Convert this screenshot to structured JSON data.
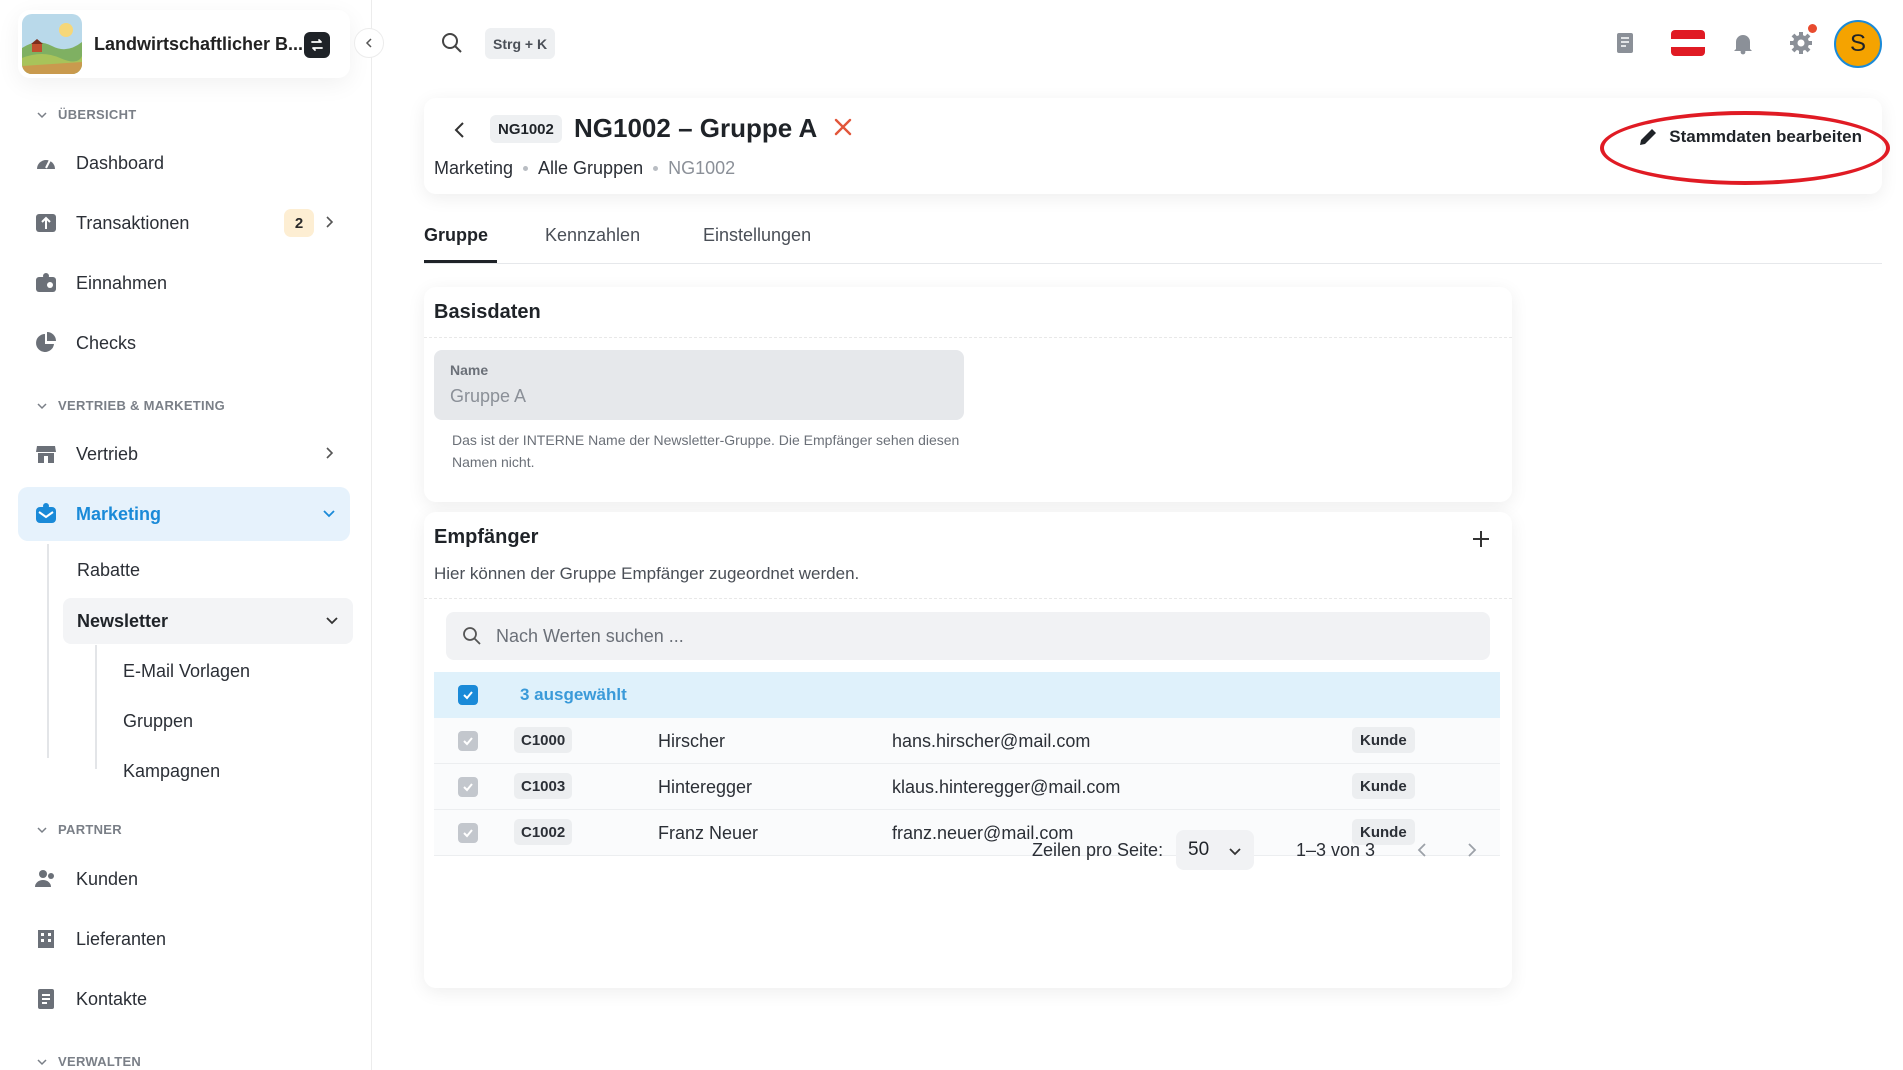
{
  "app": {
    "brand_name": "Landwirtschaftlicher B...",
    "accent_color": "#1a8ad8",
    "highlight_color": "#e01b24"
  },
  "sidebar": {
    "sections": {
      "overview": "ÜBERSICHT",
      "sales_marketing": "VERTRIEB & MARKETING",
      "partner": "PARTNER",
      "manage": "VERWALTEN"
    },
    "items": {
      "dashboard": "Dashboard",
      "transactions": "Transaktionen",
      "transactions_badge": "2",
      "income": "Einnahmen",
      "checks": "Checks",
      "sales": "Vertrieb",
      "marketing": "Marketing",
      "customers": "Kunden",
      "suppliers": "Lieferanten",
      "contacts": "Kontakte"
    },
    "marketing_sub": {
      "discounts": "Rabatte",
      "newsletter": "Newsletter",
      "email_templates": "E-Mail Vorlagen",
      "groups": "Gruppen",
      "campaigns": "Kampagnen"
    }
  },
  "topbar": {
    "search_shortcut": "Strg + K",
    "avatar_initial": "S"
  },
  "header": {
    "code": "NG1002",
    "title": "NG1002 – Gruppe A",
    "breadcrumb": [
      "Marketing",
      "Alle Gruppen",
      "NG1002"
    ],
    "edit_button": "Stammdaten bearbeiten"
  },
  "tabs": [
    "Gruppe",
    "Kennzahlen",
    "Einstellungen"
  ],
  "basisdaten": {
    "title": "Basisdaten",
    "name_label": "Name",
    "name_value": "Gruppe A",
    "helper": "Das ist der INTERNE Name der Newsletter-Gruppe. Die Empfänger sehen diesen Namen nicht."
  },
  "recipients": {
    "title": "Empfänger",
    "subtitle": "Hier können der Gruppe Empfänger zugeordnet werden.",
    "search_placeholder": "Nach Werten suchen ...",
    "selected_label": "3 ausgewählt",
    "rows": [
      {
        "code": "C1000",
        "name": "Hirscher",
        "email": "hans.hirscher@mail.com",
        "type": "Kunde"
      },
      {
        "code": "C1003",
        "name": "Hinteregger",
        "email": "klaus.hinteregger@mail.com",
        "type": "Kunde"
      },
      {
        "code": "C1002",
        "name": "Franz Neuer",
        "email": "franz.neuer@mail.com",
        "type": "Kunde"
      }
    ],
    "pager": {
      "rows_per_page_label": "Zeilen pro Seite:",
      "rows_per_page": "50",
      "range": "1–3 von 3"
    }
  }
}
